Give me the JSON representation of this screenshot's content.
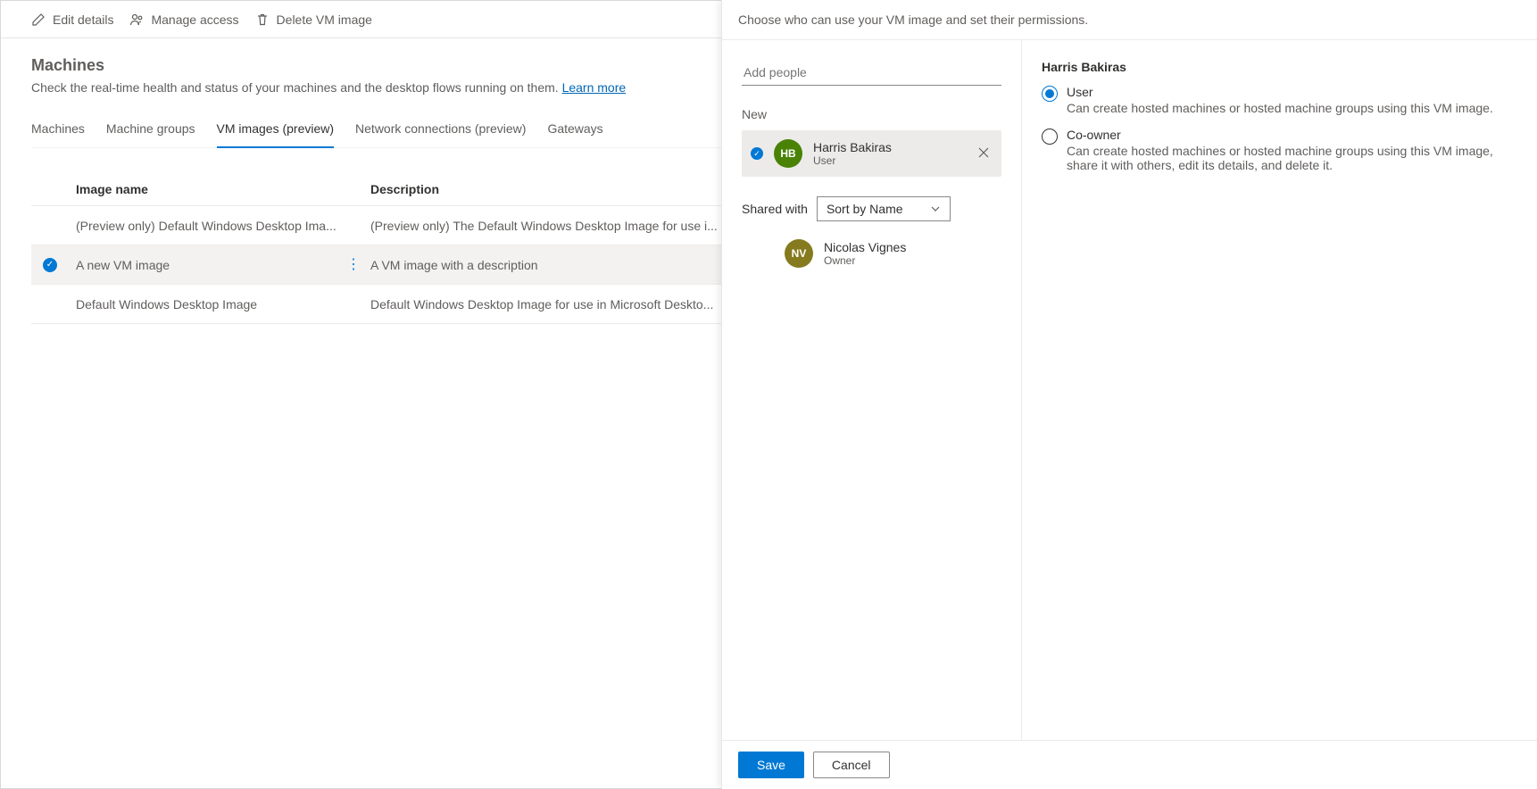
{
  "commandBar": {
    "editDetails": "Edit details",
    "manageAccess": "Manage access",
    "deleteVmImage": "Delete VM image"
  },
  "page": {
    "title": "Machines",
    "subtitle": "Check the real-time health and status of your machines and the desktop flows running on them. ",
    "learnMore": "Learn more"
  },
  "tabs": {
    "machines": "Machines",
    "machineGroups": "Machine groups",
    "vmImages": "VM images (preview)",
    "networkConnections": "Network connections (preview)",
    "gateways": "Gateways"
  },
  "table": {
    "headers": {
      "name": "Image name",
      "desc": "Description"
    },
    "rows": [
      {
        "name": "(Preview only) Default Windows Desktop Ima...",
        "desc": "(Preview only) The Default Windows Desktop Image for use i...",
        "selected": false
      },
      {
        "name": "A new VM image",
        "desc": "A VM image with a description",
        "selected": true
      },
      {
        "name": "Default Windows Desktop Image",
        "desc": "Default Windows Desktop Image for use in Microsoft Deskto...",
        "selected": false
      }
    ]
  },
  "panel": {
    "headerText": "Choose who can use your VM image and set their permissions.",
    "addPeoplePlaceholder": "Add people",
    "newLabel": "New",
    "newPerson": {
      "initials": "HB",
      "name": "Harris Bakiras",
      "role": "User"
    },
    "sharedWithLabel": "Shared with",
    "sortBy": "Sort by Name",
    "sharedOwner": {
      "initials": "NV",
      "name": "Nicolas Vignes",
      "role": "Owner"
    },
    "detailsName": "Harris Bakiras",
    "permissions": {
      "user": {
        "label": "User",
        "desc": "Can create hosted machines or hosted machine groups using this VM image."
      },
      "coowner": {
        "label": "Co-owner",
        "desc": "Can create hosted machines or hosted machine groups using this VM image, share it with others, edit its details, and delete it."
      }
    },
    "save": "Save",
    "cancel": "Cancel"
  }
}
